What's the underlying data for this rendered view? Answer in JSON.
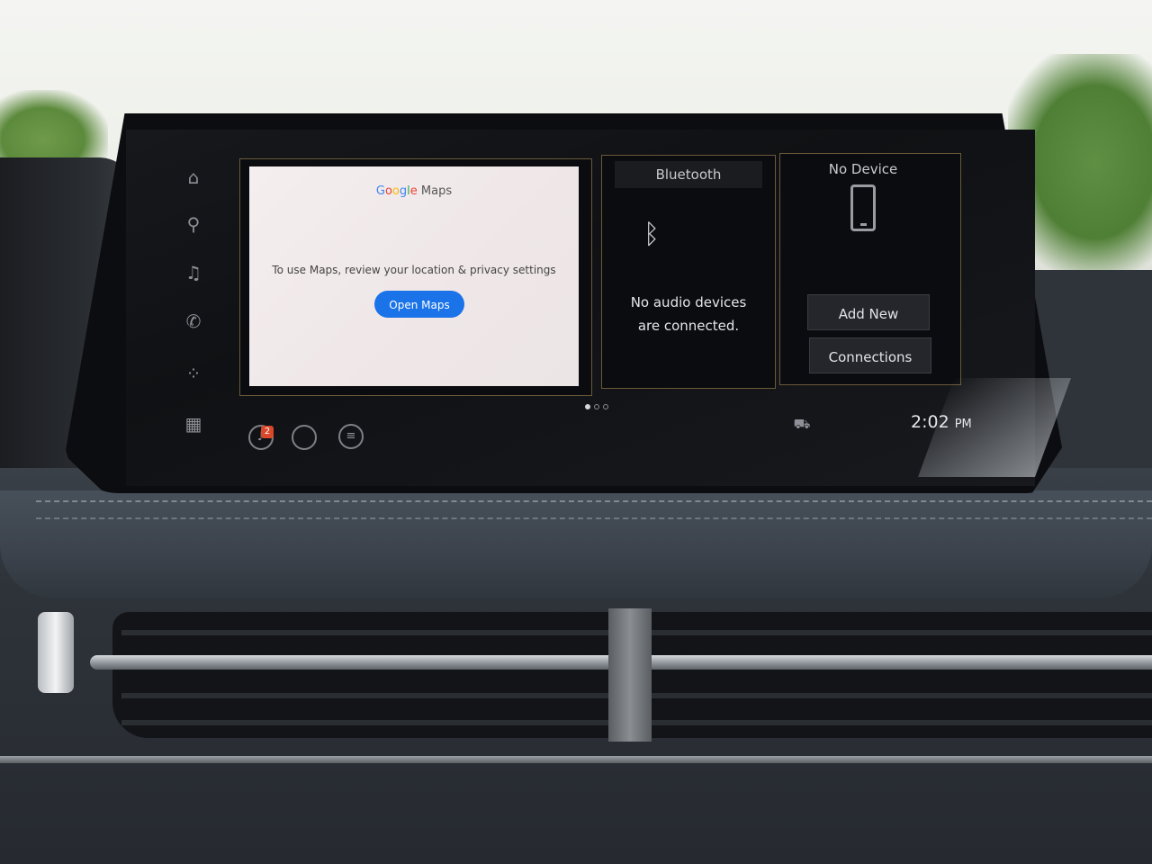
{
  "rail": {
    "items": [
      {
        "icon": "home-icon",
        "glyph": "⌂"
      },
      {
        "icon": "location-pin-icon",
        "glyph": "⚲"
      },
      {
        "icon": "music-note-icon",
        "glyph": "♫"
      },
      {
        "icon": "phone-handset-icon",
        "glyph": "✆"
      },
      {
        "icon": "voice-dots-icon",
        "glyph": "⁘"
      },
      {
        "icon": "apps-grid-icon",
        "glyph": "▦"
      }
    ]
  },
  "maps_card": {
    "logo_parts": [
      "G",
      "o",
      "o",
      "g",
      "l",
      "e"
    ],
    "logo_suffix": " Maps",
    "message": "To use Maps, review your location & privacy settings",
    "button_label": "Open Maps",
    "button_color": "#1a73e8"
  },
  "bluetooth_card": {
    "title": "Bluetooth",
    "icon": "bluetooth-icon",
    "message_line1": "No audio devices",
    "message_line2": "are connected."
  },
  "device_card": {
    "title": "No Device",
    "icon": "phone-outline-icon",
    "add_button": "Add New",
    "connections_button": "Connections"
  },
  "pagination": {
    "count": 3,
    "active_index": 0
  },
  "bottom_bar": {
    "notification_icon": "bell-icon",
    "notification_count": "2",
    "settings_icon": "sliders-icon",
    "vehicle_icon": "car-icon",
    "time": "2:02",
    "ampm": "PM"
  },
  "colors": {
    "accent_border": "#6a5a3a",
    "screen_bg": "#101114"
  }
}
